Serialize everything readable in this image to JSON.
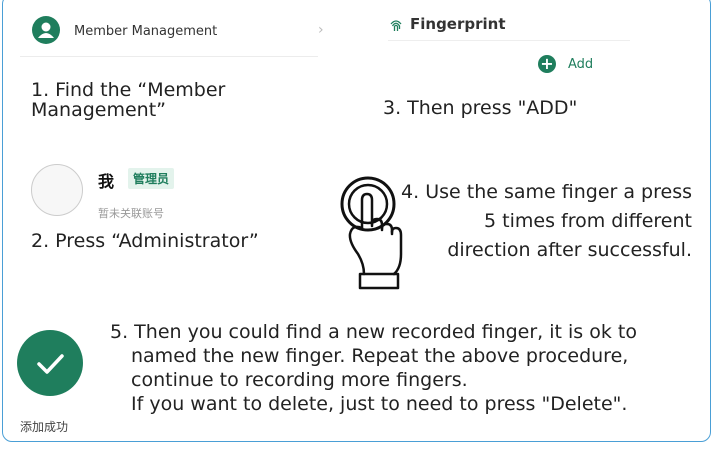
{
  "step1": {
    "menu_label": "Member Management",
    "chevron": "›",
    "instruction": "1. Find the “Member Management”"
  },
  "step2": {
    "admin_name": "我",
    "admin_badge": "管理员",
    "admin_sub": "暂未关联账号",
    "instruction": "2. Press “Administrator”"
  },
  "step3": {
    "title": "Fingerprint",
    "add_label": "Add",
    "add_symbol": "+",
    "instruction": "3. Then press \"ADD\""
  },
  "step4": {
    "number": "4.",
    "instruction": " Use the same finger a press 5 times from different direction after successful."
  },
  "step5": {
    "success_label": "添加成功",
    "line1": "5. Then you could find a new recorded finger, it is ok to",
    "line2": "named the new finger. Repeat the above procedure,",
    "line3": "continue to recording more fingers.",
    "line4": "If you want to delete, just to need to press \"Delete\"."
  },
  "icons": {
    "member": "user-icon",
    "fingerprint": "fingerprint-icon",
    "add": "plus-icon",
    "hand": "pointing-hand-icon",
    "success": "checkmark-icon"
  },
  "colors": {
    "accent": "#1f7e5d",
    "frame_border": "#4a9fd6"
  }
}
